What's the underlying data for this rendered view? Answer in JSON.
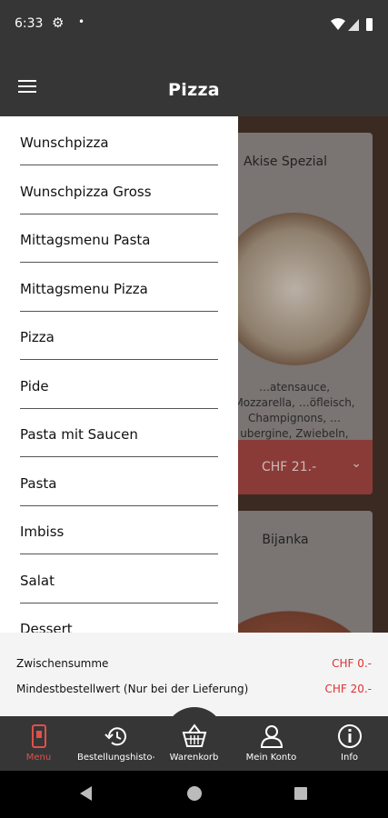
{
  "status_bar": {
    "time": "6:33",
    "gear_icon": "gear-icon",
    "notification_dot": "•"
  },
  "app_bar": {
    "title": "Pizza",
    "menu_icon": "hamburger-icon"
  },
  "drawer": {
    "items": [
      {
        "label": "Wunschpizza"
      },
      {
        "label": "Wunschpizza Gross"
      },
      {
        "label": "Mittagsmenu Pasta"
      },
      {
        "label": "Mittagsmenu Pizza"
      },
      {
        "label": "Pizza"
      },
      {
        "label": "Pide"
      },
      {
        "label": "Pasta mit Saucen"
      },
      {
        "label": "Pasta"
      },
      {
        "label": "Imbiss"
      },
      {
        "label": "Salat"
      },
      {
        "label": "Dessert"
      }
    ]
  },
  "products": [
    {
      "title": "Akise Spezial",
      "description": "…atensauce, Mozzarella, …öfleisch, Champignons, …ubergine, Zwiebeln, Taco-Sa..",
      "price": "CHF 21.-"
    },
    {
      "title": "Bijanka"
    }
  ],
  "summary": {
    "subtotal_label": "Zwischensumme",
    "subtotal_value": "CHF 0.-",
    "minimum_label": "Mindestbestellwert (Nur bei der Lieferung)",
    "minimum_value": "CHF 20.-"
  },
  "bottom_nav": {
    "items": [
      {
        "label": "Menu",
        "icon": "phone-menu-icon",
        "active": true
      },
      {
        "label": "Bestellungshisto-",
        "icon": "history-icon",
        "active": false
      },
      {
        "label": "Warenkorb",
        "icon": "basket-icon",
        "active": false
      },
      {
        "label": "Mein Konto",
        "icon": "user-icon",
        "active": false
      },
      {
        "label": "Info",
        "icon": "info-icon",
        "active": false
      }
    ]
  },
  "colors": {
    "accent": "#e0504a",
    "bar": "#363636",
    "price_red": "#e03030"
  }
}
